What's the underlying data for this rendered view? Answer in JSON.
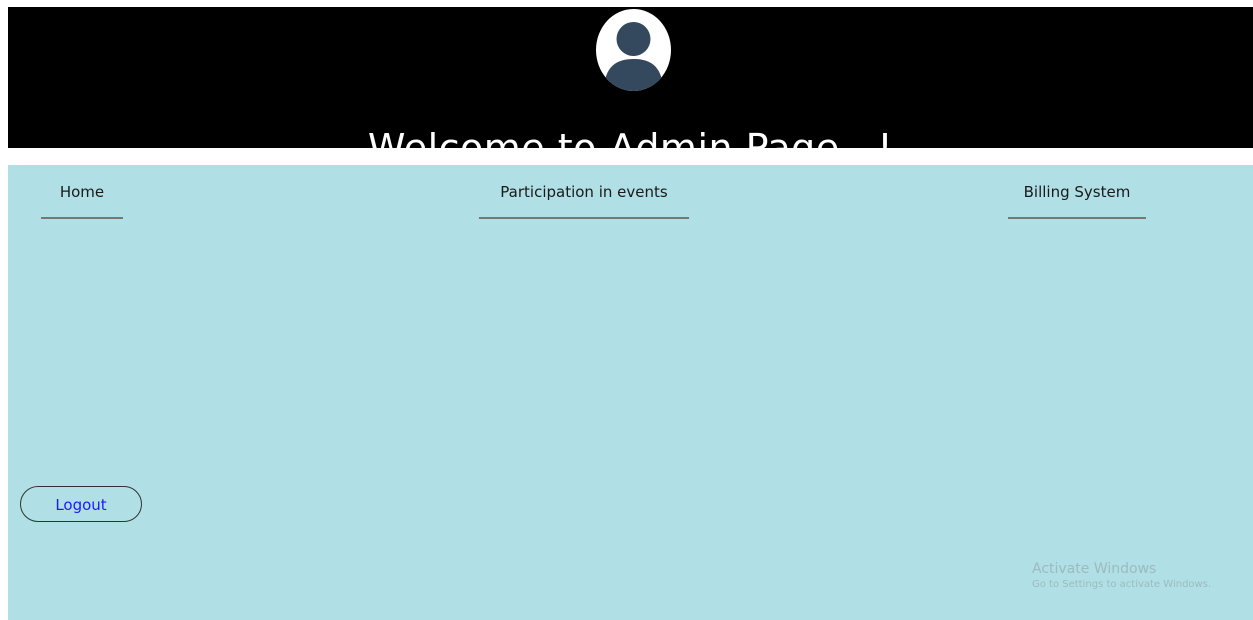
{
  "header": {
    "title": "Welcome to Admin Page...!",
    "avatar_icon": "user-avatar-icon"
  },
  "nav": {
    "home": "Home",
    "events": "Participation in events",
    "billing": "Billing System"
  },
  "logout_label": "Logout",
  "watermark": {
    "title": "Activate Windows",
    "subtitle": "Go to Settings to activate Windows."
  },
  "colors": {
    "header_bg": "#000000",
    "content_bg": "#b0dfe5",
    "avatar_fill": "#34495e",
    "logout_text": "#1a1aff"
  }
}
